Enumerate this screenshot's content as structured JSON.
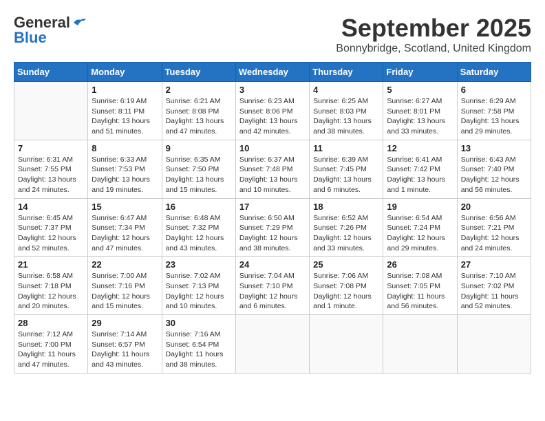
{
  "header": {
    "logo_general": "General",
    "logo_blue": "Blue",
    "month_title": "September 2025",
    "location": "Bonnybridge, Scotland, United Kingdom"
  },
  "days_of_week": [
    "Sunday",
    "Monday",
    "Tuesday",
    "Wednesday",
    "Thursday",
    "Friday",
    "Saturday"
  ],
  "weeks": [
    [
      {
        "day": "",
        "sunrise": "",
        "sunset": "",
        "daylight": ""
      },
      {
        "day": "1",
        "sunrise": "Sunrise: 6:19 AM",
        "sunset": "Sunset: 8:11 PM",
        "daylight": "Daylight: 13 hours and 51 minutes."
      },
      {
        "day": "2",
        "sunrise": "Sunrise: 6:21 AM",
        "sunset": "Sunset: 8:08 PM",
        "daylight": "Daylight: 13 hours and 47 minutes."
      },
      {
        "day": "3",
        "sunrise": "Sunrise: 6:23 AM",
        "sunset": "Sunset: 8:06 PM",
        "daylight": "Daylight: 13 hours and 42 minutes."
      },
      {
        "day": "4",
        "sunrise": "Sunrise: 6:25 AM",
        "sunset": "Sunset: 8:03 PM",
        "daylight": "Daylight: 13 hours and 38 minutes."
      },
      {
        "day": "5",
        "sunrise": "Sunrise: 6:27 AM",
        "sunset": "Sunset: 8:01 PM",
        "daylight": "Daylight: 13 hours and 33 minutes."
      },
      {
        "day": "6",
        "sunrise": "Sunrise: 6:29 AM",
        "sunset": "Sunset: 7:58 PM",
        "daylight": "Daylight: 13 hours and 29 minutes."
      }
    ],
    [
      {
        "day": "7",
        "sunrise": "Sunrise: 6:31 AM",
        "sunset": "Sunset: 7:55 PM",
        "daylight": "Daylight: 13 hours and 24 minutes."
      },
      {
        "day": "8",
        "sunrise": "Sunrise: 6:33 AM",
        "sunset": "Sunset: 7:53 PM",
        "daylight": "Daylight: 13 hours and 19 minutes."
      },
      {
        "day": "9",
        "sunrise": "Sunrise: 6:35 AM",
        "sunset": "Sunset: 7:50 PM",
        "daylight": "Daylight: 13 hours and 15 minutes."
      },
      {
        "day": "10",
        "sunrise": "Sunrise: 6:37 AM",
        "sunset": "Sunset: 7:48 PM",
        "daylight": "Daylight: 13 hours and 10 minutes."
      },
      {
        "day": "11",
        "sunrise": "Sunrise: 6:39 AM",
        "sunset": "Sunset: 7:45 PM",
        "daylight": "Daylight: 13 hours and 6 minutes."
      },
      {
        "day": "12",
        "sunrise": "Sunrise: 6:41 AM",
        "sunset": "Sunset: 7:42 PM",
        "daylight": "Daylight: 13 hours and 1 minute."
      },
      {
        "day": "13",
        "sunrise": "Sunrise: 6:43 AM",
        "sunset": "Sunset: 7:40 PM",
        "daylight": "Daylight: 12 hours and 56 minutes."
      }
    ],
    [
      {
        "day": "14",
        "sunrise": "Sunrise: 6:45 AM",
        "sunset": "Sunset: 7:37 PM",
        "daylight": "Daylight: 12 hours and 52 minutes."
      },
      {
        "day": "15",
        "sunrise": "Sunrise: 6:47 AM",
        "sunset": "Sunset: 7:34 PM",
        "daylight": "Daylight: 12 hours and 47 minutes."
      },
      {
        "day": "16",
        "sunrise": "Sunrise: 6:48 AM",
        "sunset": "Sunset: 7:32 PM",
        "daylight": "Daylight: 12 hours and 43 minutes."
      },
      {
        "day": "17",
        "sunrise": "Sunrise: 6:50 AM",
        "sunset": "Sunset: 7:29 PM",
        "daylight": "Daylight: 12 hours and 38 minutes."
      },
      {
        "day": "18",
        "sunrise": "Sunrise: 6:52 AM",
        "sunset": "Sunset: 7:26 PM",
        "daylight": "Daylight: 12 hours and 33 minutes."
      },
      {
        "day": "19",
        "sunrise": "Sunrise: 6:54 AM",
        "sunset": "Sunset: 7:24 PM",
        "daylight": "Daylight: 12 hours and 29 minutes."
      },
      {
        "day": "20",
        "sunrise": "Sunrise: 6:56 AM",
        "sunset": "Sunset: 7:21 PM",
        "daylight": "Daylight: 12 hours and 24 minutes."
      }
    ],
    [
      {
        "day": "21",
        "sunrise": "Sunrise: 6:58 AM",
        "sunset": "Sunset: 7:18 PM",
        "daylight": "Daylight: 12 hours and 20 minutes."
      },
      {
        "day": "22",
        "sunrise": "Sunrise: 7:00 AM",
        "sunset": "Sunset: 7:16 PM",
        "daylight": "Daylight: 12 hours and 15 minutes."
      },
      {
        "day": "23",
        "sunrise": "Sunrise: 7:02 AM",
        "sunset": "Sunset: 7:13 PM",
        "daylight": "Daylight: 12 hours and 10 minutes."
      },
      {
        "day": "24",
        "sunrise": "Sunrise: 7:04 AM",
        "sunset": "Sunset: 7:10 PM",
        "daylight": "Daylight: 12 hours and 6 minutes."
      },
      {
        "day": "25",
        "sunrise": "Sunrise: 7:06 AM",
        "sunset": "Sunset: 7:08 PM",
        "daylight": "Daylight: 12 hours and 1 minute."
      },
      {
        "day": "26",
        "sunrise": "Sunrise: 7:08 AM",
        "sunset": "Sunset: 7:05 PM",
        "daylight": "Daylight: 11 hours and 56 minutes."
      },
      {
        "day": "27",
        "sunrise": "Sunrise: 7:10 AM",
        "sunset": "Sunset: 7:02 PM",
        "daylight": "Daylight: 11 hours and 52 minutes."
      }
    ],
    [
      {
        "day": "28",
        "sunrise": "Sunrise: 7:12 AM",
        "sunset": "Sunset: 7:00 PM",
        "daylight": "Daylight: 11 hours and 47 minutes."
      },
      {
        "day": "29",
        "sunrise": "Sunrise: 7:14 AM",
        "sunset": "Sunset: 6:57 PM",
        "daylight": "Daylight: 11 hours and 43 minutes."
      },
      {
        "day": "30",
        "sunrise": "Sunrise: 7:16 AM",
        "sunset": "Sunset: 6:54 PM",
        "daylight": "Daylight: 11 hours and 38 minutes."
      },
      {
        "day": "",
        "sunrise": "",
        "sunset": "",
        "daylight": ""
      },
      {
        "day": "",
        "sunrise": "",
        "sunset": "",
        "daylight": ""
      },
      {
        "day": "",
        "sunrise": "",
        "sunset": "",
        "daylight": ""
      },
      {
        "day": "",
        "sunrise": "",
        "sunset": "",
        "daylight": ""
      }
    ]
  ]
}
